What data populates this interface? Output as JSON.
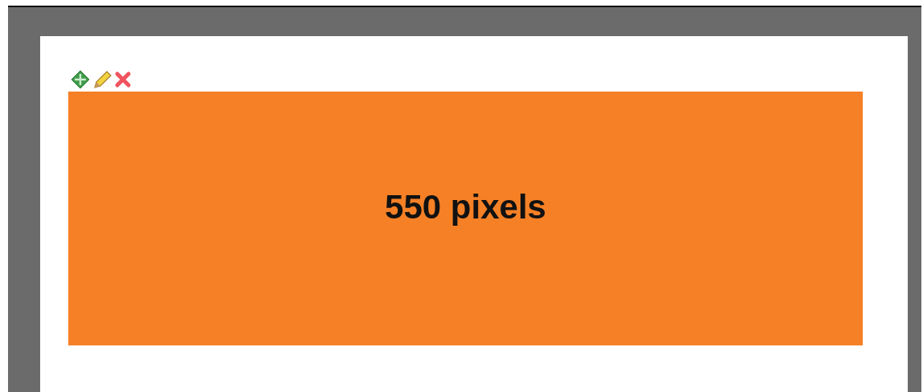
{
  "block": {
    "label": "550 pixels"
  }
}
